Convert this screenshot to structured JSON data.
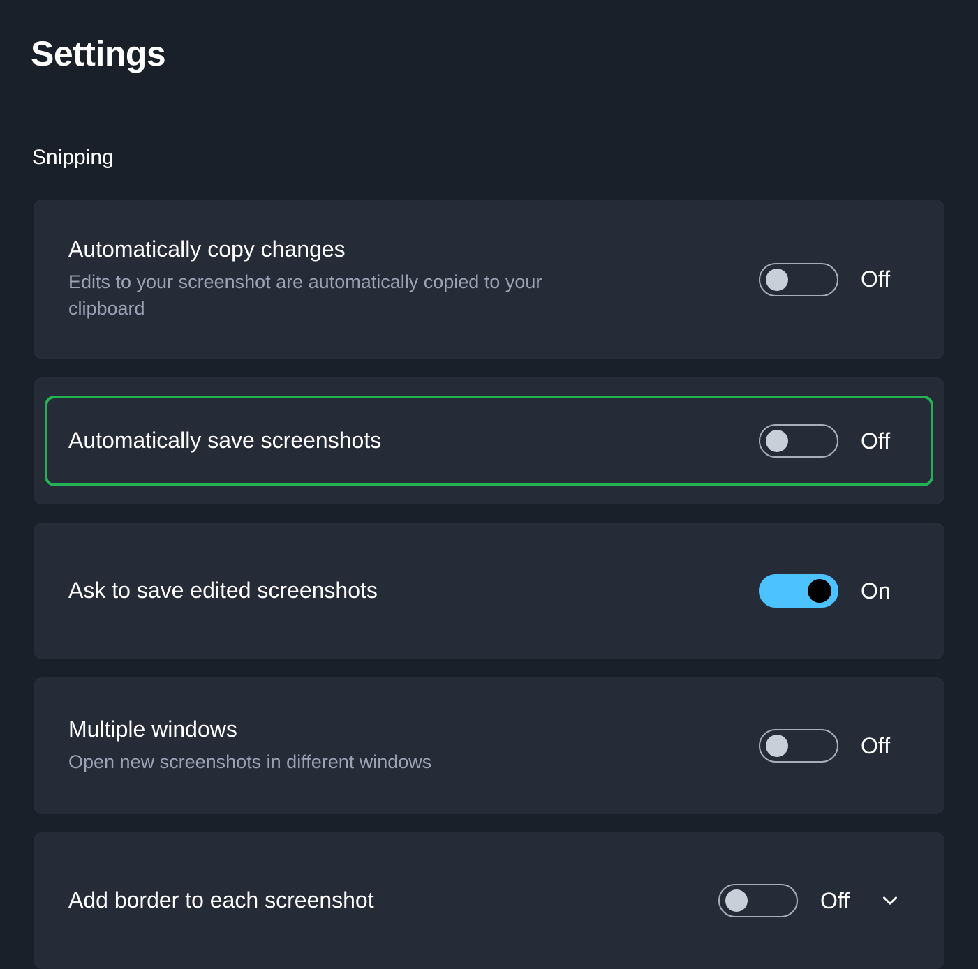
{
  "page": {
    "title": "Settings",
    "section_label": "Snipping",
    "background_color": "#1a2029",
    "card_color": "#262b38",
    "accent_on_color": "#4cc2ff",
    "highlight_color": "#22b254"
  },
  "settings": [
    {
      "title": "Automatically copy changes",
      "description": "Edits to your screenshot are automatically copied to your clipboard",
      "state": "Off",
      "toggle_on": false,
      "highlighted": false,
      "chevron": false
    },
    {
      "title": "Automatically save screenshots",
      "description": "",
      "state": "Off",
      "toggle_on": false,
      "highlighted": true,
      "chevron": false
    },
    {
      "title": "Ask to save edited screenshots",
      "description": "",
      "state": "On",
      "toggle_on": true,
      "highlighted": false,
      "chevron": false
    },
    {
      "title": "Multiple windows",
      "description": "Open new screenshots in different windows",
      "state": "Off",
      "toggle_on": false,
      "highlighted": false,
      "chevron": false
    },
    {
      "title": "Add border to each screenshot",
      "description": "",
      "state": "Off",
      "toggle_on": false,
      "highlighted": false,
      "chevron": true,
      "chevron_icon": "chevron-down-icon"
    }
  ]
}
